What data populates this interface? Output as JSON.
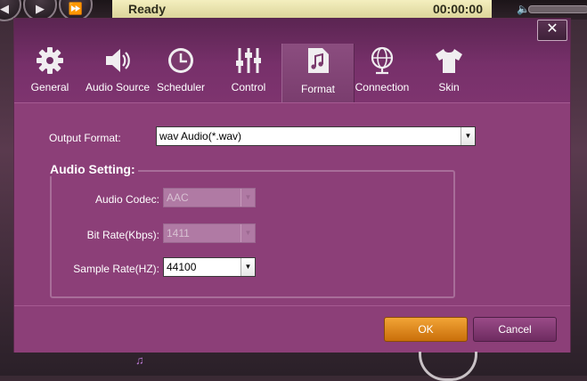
{
  "player": {
    "status": "Ready",
    "time": "00:00:00",
    "play_icon": "play-icon",
    "forward_icon": "fast-forward-icon"
  },
  "dialog": {
    "close_icon": "close-icon",
    "tabs": [
      {
        "label": "General",
        "icon": "gear-icon"
      },
      {
        "label": "Audio Source",
        "icon": "speaker-icon"
      },
      {
        "label": "Scheduler",
        "icon": "clock-icon"
      },
      {
        "label": "Control",
        "icon": "sliders-icon"
      },
      {
        "label": "Format",
        "icon": "music-note-icon",
        "active": true
      },
      {
        "label": "Connection",
        "icon": "globe-icon"
      },
      {
        "label": "Skin",
        "icon": "tshirt-icon"
      }
    ],
    "output_format": {
      "label": "Output Format:",
      "value": "wav Audio(*.wav)"
    },
    "audio_setting": {
      "title": "Audio Setting:",
      "codec": {
        "label": "Audio Codec:",
        "value": "AAC",
        "disabled": true
      },
      "bitrate": {
        "label": "Bit Rate(Kbps):",
        "value": "1411",
        "disabled": true
      },
      "samplerate": {
        "label": "Sample Rate(HZ):",
        "value": "44100",
        "disabled": false
      }
    },
    "buttons": {
      "ok": "OK",
      "cancel": "Cancel"
    }
  },
  "colors": {
    "dialog_bg": "#8c3f78",
    "ok_button": "#e08a1e",
    "cancel_button": "#84396f"
  }
}
